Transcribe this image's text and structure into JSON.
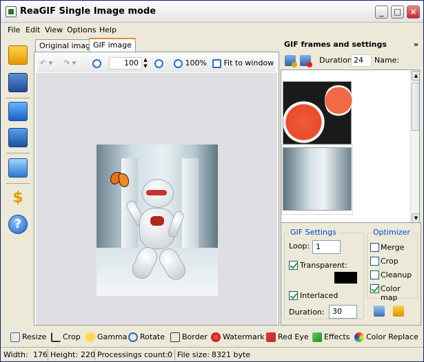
{
  "window": {
    "title": "ReaGIF Single Image mode"
  },
  "menu": [
    "File",
    "Edit",
    "View",
    "Options",
    "Help"
  ],
  "tabs": {
    "original": "Original image",
    "gif": "GIF image"
  },
  "image_toolbar": {
    "zoom_value": "100",
    "zoom_100": "100%",
    "fit": "Fit to window"
  },
  "right_panel": {
    "title": "GIF frames and settings",
    "chevron": "»",
    "duration_label": "Duration:",
    "duration_value": "24",
    "name_label": "Name:"
  },
  "gif_settings": {
    "title": "GIF Settings",
    "loop_label": "Loop:",
    "loop_value": "1",
    "transparent_label": "Transparent:",
    "transparent_checked": true,
    "transparent_color": "#000000",
    "interlaced_label": "Interlaced",
    "interlaced_checked": true,
    "duration_label": "Duration:",
    "duration_value": "30"
  },
  "optimizer": {
    "title": "Optimizer",
    "merge": "Merge",
    "crop": "Crop",
    "cleanup": "Cleanup",
    "color_map": "Color map"
  },
  "bottom_toolbar": [
    "Resize",
    "Crop",
    "Gamma",
    "Rotate",
    "Border",
    "Watermark",
    "Red Eye",
    "Effects",
    "Color Replace"
  ],
  "status": {
    "width_label": "Width:",
    "width_value": "176",
    "height_label": "Height:",
    "height_value": "220",
    "proc_label": "Processings count:",
    "proc_value": "0",
    "size_label": "File size:",
    "size_value": "8321 byte"
  }
}
